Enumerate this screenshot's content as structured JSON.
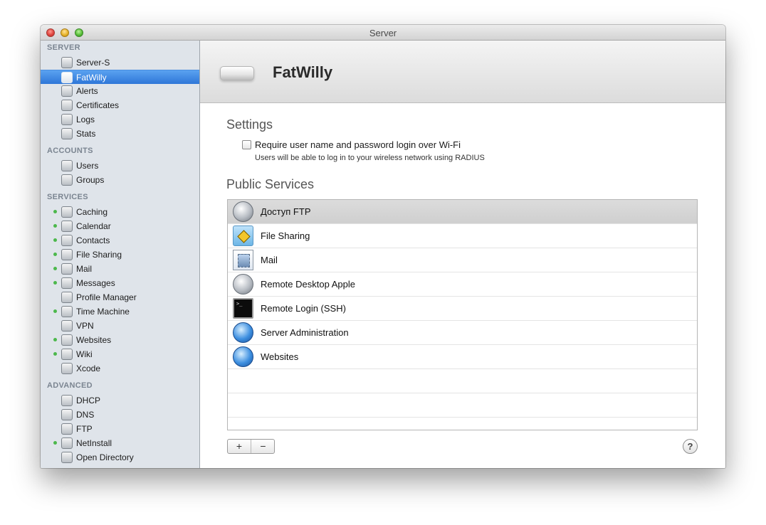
{
  "window": {
    "title": "Server"
  },
  "sidebar": {
    "sections": [
      {
        "header": "SERVER",
        "items": [
          {
            "label": "Server-S",
            "icon": "server-icon",
            "status": false
          },
          {
            "label": "FatWilly",
            "icon": "airport-icon",
            "status": false,
            "selected": true
          },
          {
            "label": "Alerts",
            "icon": "megaphone-icon",
            "status": false
          },
          {
            "label": "Certificates",
            "icon": "certificate-icon",
            "status": false
          },
          {
            "label": "Logs",
            "icon": "log-icon",
            "status": false
          },
          {
            "label": "Stats",
            "icon": "stats-icon",
            "status": false
          }
        ]
      },
      {
        "header": "ACCOUNTS",
        "items": [
          {
            "label": "Users",
            "icon": "user-icon",
            "status": false
          },
          {
            "label": "Groups",
            "icon": "group-icon",
            "status": false
          }
        ]
      },
      {
        "header": "SERVICES",
        "items": [
          {
            "label": "Caching",
            "icon": "caching-icon",
            "status": true
          },
          {
            "label": "Calendar",
            "icon": "calendar-icon",
            "status": true
          },
          {
            "label": "Contacts",
            "icon": "contacts-icon",
            "status": true
          },
          {
            "label": "File Sharing",
            "icon": "file-sharing-icon",
            "status": true
          },
          {
            "label": "Mail",
            "icon": "mail-icon",
            "status": true
          },
          {
            "label": "Messages",
            "icon": "messages-icon",
            "status": true
          },
          {
            "label": "Profile Manager",
            "icon": "profile-manager-icon",
            "status": false
          },
          {
            "label": "Time Machine",
            "icon": "time-machine-icon",
            "status": true
          },
          {
            "label": "VPN",
            "icon": "vpn-icon",
            "status": false
          },
          {
            "label": "Websites",
            "icon": "websites-icon",
            "status": true
          },
          {
            "label": "Wiki",
            "icon": "wiki-icon",
            "status": true
          },
          {
            "label": "Xcode",
            "icon": "xcode-icon",
            "status": false
          }
        ]
      },
      {
        "header": "ADVANCED",
        "items": [
          {
            "label": "DHCP",
            "icon": "dhcp-icon",
            "status": false
          },
          {
            "label": "DNS",
            "icon": "dns-icon",
            "status": false
          },
          {
            "label": "FTP",
            "icon": "ftp-icon",
            "status": false
          },
          {
            "label": "NetInstall",
            "icon": "netinstall-icon",
            "status": true
          },
          {
            "label": "Open Directory",
            "icon": "open-directory-icon",
            "status": false
          }
        ]
      }
    ],
    "status_color": "#4cb84c",
    "selected_color": "#2e76d8"
  },
  "main": {
    "device_name": "FatWilly",
    "settings": {
      "title": "Settings",
      "checkbox_label": "Require user name and password login over Wi-Fi",
      "checkbox_checked": false,
      "checkbox_help": "Users will be able to log in to your wireless network using RADIUS"
    },
    "public_services": {
      "title": "Public Services",
      "items": [
        {
          "label": "Доступ FTP",
          "icon": "globe-gray-icon",
          "selected": true
        },
        {
          "label": "File Sharing",
          "icon": "folder-icon"
        },
        {
          "label": "Mail",
          "icon": "mail-stamp-icon"
        },
        {
          "label": "Remote Desktop Apple",
          "icon": "globe-gray-icon"
        },
        {
          "label": "Remote Login (SSH)",
          "icon": "terminal-icon"
        },
        {
          "label": "Server Administration",
          "icon": "globe-blue-icon"
        },
        {
          "label": "Websites",
          "icon": "globe-blue-icon"
        }
      ]
    },
    "add_label": "+",
    "remove_label": "−",
    "help_label": "?"
  }
}
